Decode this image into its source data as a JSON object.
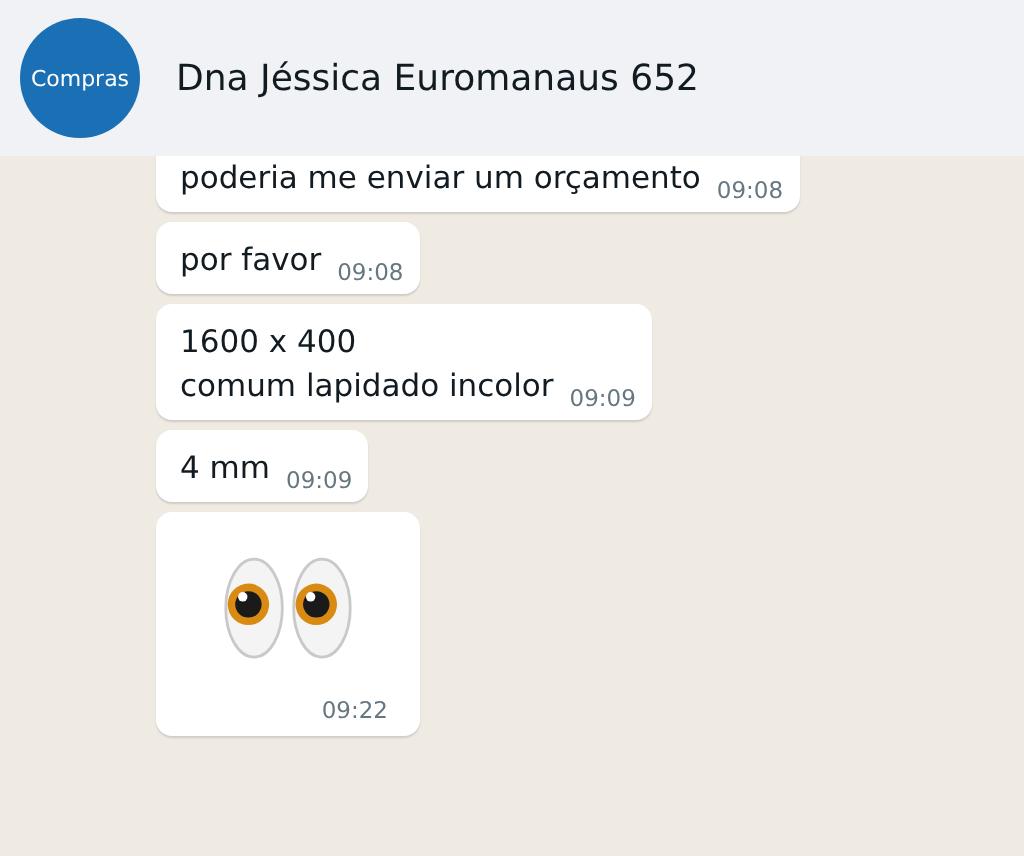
{
  "header": {
    "avatar_label": "Compras",
    "title": "Dna Jéssica Euromanaus 652"
  },
  "messages": [
    {
      "kind": "text",
      "text": "poderia me enviar um orçamento",
      "time": "09:08",
      "cut_top": true
    },
    {
      "kind": "text",
      "text": "por favor",
      "time": "09:08"
    },
    {
      "kind": "text",
      "text": "1600 x 400\ncomum lapidado incolor",
      "time": "09:09"
    },
    {
      "kind": "text",
      "text": "4 mm",
      "time": "09:09"
    },
    {
      "kind": "eyes",
      "time": "09:22"
    }
  ]
}
